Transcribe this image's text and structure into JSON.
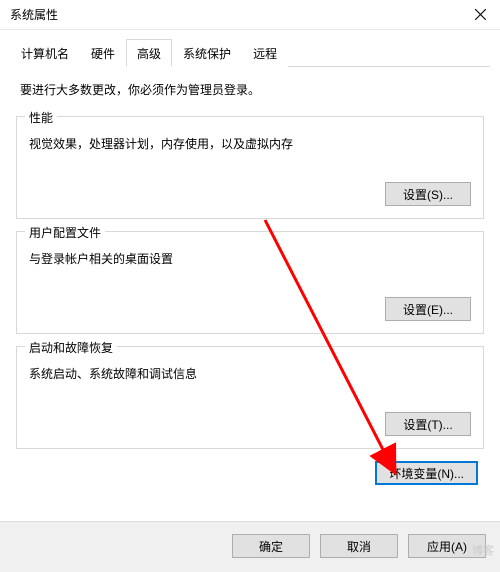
{
  "titlebar": {
    "title": "系统属性"
  },
  "tabs": {
    "items": [
      {
        "label": "计算机名"
      },
      {
        "label": "硬件"
      },
      {
        "label": "高级",
        "active": true
      },
      {
        "label": "系统保护"
      },
      {
        "label": "远程"
      }
    ]
  },
  "intro": "要进行大多数更改，你必须作为管理员登录。",
  "groups": {
    "performance": {
      "title": "性能",
      "desc": "视觉效果，处理器计划，内存使用，以及虚拟内存",
      "button": "设置(S)..."
    },
    "profiles": {
      "title": "用户配置文件",
      "desc": "与登录帐户相关的桌面设置",
      "button": "设置(E)..."
    },
    "startup": {
      "title": "启动和故障恢复",
      "desc": "系统启动、系统故障和调试信息",
      "button": "设置(T)..."
    }
  },
  "env_button": "环境变量(N)...",
  "footer": {
    "ok": "确定",
    "cancel": "取消",
    "apply": "应用(A)"
  },
  "watermark": "博客"
}
